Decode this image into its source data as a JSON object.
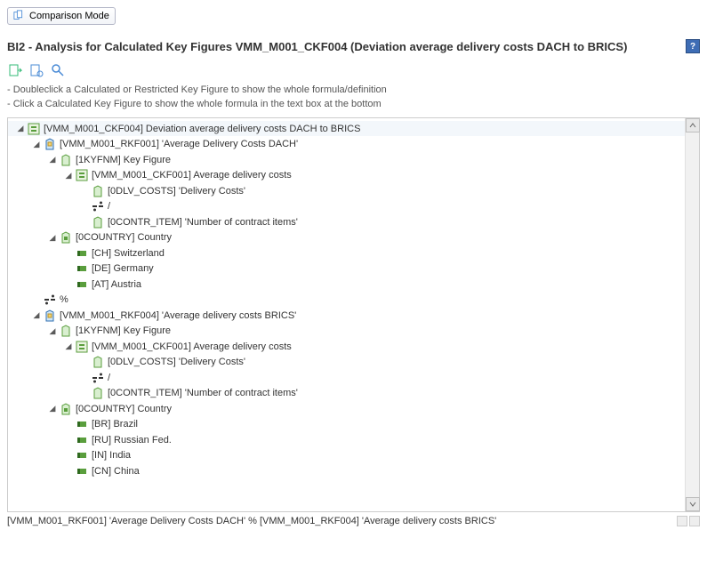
{
  "buttons": {
    "comparison": "Comparison Mode"
  },
  "title": "BI2 - Analysis for Calculated Key Figures VMM_M001_CKF004 (Deviation average delivery costs DACH to BRICS)",
  "help": "?",
  "hints": [
    "- Doubleclick a Calculated or Restricted Key Figure to show the whole formula/definition",
    "- Click a Calculated Key Figure to show the whole formula in the text box at the bottom"
  ],
  "tree": [
    {
      "depth": 0,
      "expand": "open",
      "icon": "ckf",
      "label": "[VMM_M001_CKF004] Deviation average delivery costs DACH to BRICS",
      "hl": true
    },
    {
      "depth": 1,
      "expand": "open",
      "icon": "rkf",
      "label": "[VMM_M001_RKF001] 'Average Delivery Costs DACH'"
    },
    {
      "depth": 2,
      "expand": "open",
      "icon": "kf",
      "label": "[1KYFNM] Key Figure"
    },
    {
      "depth": 3,
      "expand": "open",
      "icon": "ckf",
      "label": "[VMM_M001_CKF001] Average delivery costs"
    },
    {
      "depth": 4,
      "expand": "none",
      "icon": "kf",
      "label": "[0DLV_COSTS] 'Delivery Costs'"
    },
    {
      "depth": 4,
      "expand": "none",
      "icon": "op",
      "label": "/"
    },
    {
      "depth": 4,
      "expand": "none",
      "icon": "kf",
      "label": "[0CONTR_ITEM] 'Number of contract items'"
    },
    {
      "depth": 2,
      "expand": "open",
      "icon": "dim",
      "label": "[0COUNTRY] Country"
    },
    {
      "depth": 3,
      "expand": "none",
      "icon": "val",
      "label": "[CH] Switzerland"
    },
    {
      "depth": 3,
      "expand": "none",
      "icon": "val",
      "label": "[DE] Germany"
    },
    {
      "depth": 3,
      "expand": "none",
      "icon": "val",
      "label": "[AT] Austria"
    },
    {
      "depth": 1,
      "expand": "none",
      "icon": "op",
      "label": "%"
    },
    {
      "depth": 1,
      "expand": "open",
      "icon": "rkf",
      "label": "[VMM_M001_RKF004] 'Average delivery costs BRICS'"
    },
    {
      "depth": 2,
      "expand": "open",
      "icon": "kf",
      "label": "[1KYFNM] Key Figure"
    },
    {
      "depth": 3,
      "expand": "open",
      "icon": "ckf",
      "label": "[VMM_M001_CKF001] Average delivery costs"
    },
    {
      "depth": 4,
      "expand": "none",
      "icon": "kf",
      "label": "[0DLV_COSTS] 'Delivery Costs'"
    },
    {
      "depth": 4,
      "expand": "none",
      "icon": "op",
      "label": "/"
    },
    {
      "depth": 4,
      "expand": "none",
      "icon": "kf",
      "label": "[0CONTR_ITEM] 'Number of contract items'"
    },
    {
      "depth": 2,
      "expand": "open",
      "icon": "dim",
      "label": "[0COUNTRY] Country"
    },
    {
      "depth": 3,
      "expand": "none",
      "icon": "val",
      "label": "[BR] Brazil"
    },
    {
      "depth": 3,
      "expand": "none",
      "icon": "val",
      "label": "[RU] Russian Fed."
    },
    {
      "depth": 3,
      "expand": "none",
      "icon": "val",
      "label": "[IN] India"
    },
    {
      "depth": 3,
      "expand": "none",
      "icon": "val",
      "label": "[CN] China"
    }
  ],
  "status": "[VMM_M001_RKF001] 'Average Delivery Costs DACH' % [VMM_M001_RKF004] 'Average delivery costs BRICS'",
  "icons": {
    "ckf": "calculated-keyfigure-icon",
    "rkf": "restricted-keyfigure-icon",
    "kf": "keyfigure-icon",
    "dim": "characteristic-icon",
    "val": "value-icon",
    "op": "operator-icon"
  }
}
